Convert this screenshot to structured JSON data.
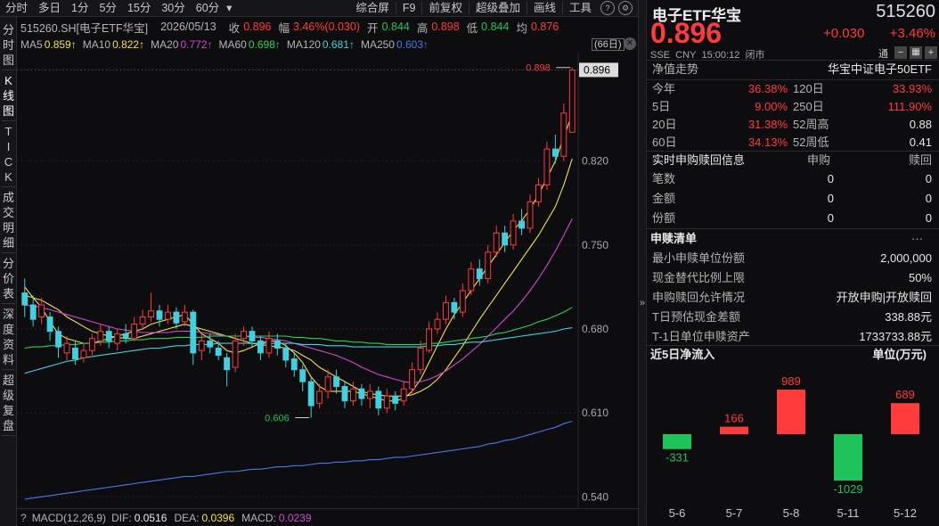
{
  "toolbar": {
    "items": [
      "分时",
      "多日",
      "1分",
      "5分",
      "15分",
      "30分",
      "60分"
    ],
    "right_items": [
      "综合屏",
      "F9",
      "前复权",
      "超级叠加",
      "画线",
      "工具"
    ]
  },
  "vtabs": {
    "groups": [
      [
        "分",
        "时",
        "图"
      ],
      [
        "K",
        "线",
        "图"
      ],
      [
        "T",
        "I",
        "C",
        "K"
      ],
      [
        "成",
        "交",
        "明",
        "细"
      ],
      [
        "分",
        "价",
        "表"
      ],
      [
        "深",
        "度",
        "资",
        "料"
      ],
      [
        "超",
        "级",
        "复",
        "盘"
      ]
    ]
  },
  "header": {
    "symbol": "515260.SH[电子ETF华宝]",
    "date": "2026/05/13",
    "close_label": "收",
    "close": "0.896",
    "change_label": "幅",
    "change": "3.46%(0.030)",
    "open_label": "开",
    "open": "0.844",
    "high_label": "高",
    "high": "0.898",
    "low_label": "低",
    "low": "0.844",
    "avg_label": "均",
    "avg": "0.876"
  },
  "ma": [
    {
      "label": "MA5",
      "value": "0.859↑",
      "color": "#f5e14b"
    },
    {
      "label": "MA10",
      "value": "0.822↑",
      "color": "#f5e14b"
    },
    {
      "label": "MA20",
      "value": "0.772↑",
      "color": "#d04ad0"
    },
    {
      "label": "MA60",
      "value": "0.698↑",
      "color": "#2ed15a"
    },
    {
      "label": "MA120",
      "value": "0.681↑",
      "color": "#40d0e0"
    },
    {
      "label": "MA250",
      "value": "0.603↑",
      "color": "#4a78e8"
    }
  ],
  "days_badge": "(66日)",
  "macd": {
    "label": "MACD(12,26,9)",
    "dif_label": "DIF:",
    "dif": "0.0516",
    "dea_label": "DEA:",
    "dea": "0.0396",
    "macd_label": "MACD:",
    "macd": "0.0239"
  },
  "chart_data": {
    "type": "candlestick",
    "ylim": [
      0.535,
      0.903
    ],
    "y_ticks": [
      "0.896",
      "0.820",
      "0.750",
      "0.680",
      "0.610",
      "0.540"
    ],
    "max_label": "0.898",
    "min_label": "0.606",
    "last_price": "0.896",
    "candles": [
      [
        0.71,
        0.7,
        0.722,
        0.69
      ],
      [
        0.7,
        0.688,
        0.708,
        0.682
      ],
      [
        0.69,
        0.7,
        0.706,
        0.684
      ],
      [
        0.69,
        0.678,
        0.694,
        0.67
      ],
      [
        0.678,
        0.665,
        0.682,
        0.656
      ],
      [
        0.66,
        0.668,
        0.674,
        0.654
      ],
      [
        0.664,
        0.655,
        0.67,
        0.65
      ],
      [
        0.656,
        0.662,
        0.668,
        0.652
      ],
      [
        0.662,
        0.672,
        0.676,
        0.658
      ],
      [
        0.67,
        0.678,
        0.684,
        0.666
      ],
      [
        0.678,
        0.67,
        0.682,
        0.664
      ],
      [
        0.668,
        0.676,
        0.68,
        0.662
      ],
      [
        0.676,
        0.672,
        0.684,
        0.668
      ],
      [
        0.672,
        0.684,
        0.69,
        0.67
      ],
      [
        0.684,
        0.69,
        0.696,
        0.68
      ],
      [
        0.69,
        0.695,
        0.71,
        0.686
      ],
      [
        0.695,
        0.688,
        0.7,
        0.682
      ],
      [
        0.688,
        0.694,
        0.7,
        0.684
      ],
      [
        0.694,
        0.685,
        0.698,
        0.68
      ],
      [
        0.686,
        0.694,
        0.7,
        0.682
      ],
      [
        0.694,
        0.66,
        0.696,
        0.65
      ],
      [
        0.662,
        0.67,
        0.676,
        0.654
      ],
      [
        0.67,
        0.665,
        0.676,
        0.66
      ],
      [
        0.664,
        0.658,
        0.67,
        0.654
      ],
      [
        0.656,
        0.646,
        0.66,
        0.632
      ],
      [
        0.648,
        0.67,
        0.676,
        0.644
      ],
      [
        0.672,
        0.678,
        0.682,
        0.666
      ],
      [
        0.678,
        0.67,
        0.682,
        0.664
      ],
      [
        0.67,
        0.66,
        0.674,
        0.654
      ],
      [
        0.66,
        0.672,
        0.678,
        0.656
      ],
      [
        0.67,
        0.664,
        0.676,
        0.658
      ],
      [
        0.664,
        0.654,
        0.668,
        0.648
      ],
      [
        0.655,
        0.646,
        0.66,
        0.64
      ],
      [
        0.646,
        0.636,
        0.65,
        0.628
      ],
      [
        0.636,
        0.616,
        0.64,
        0.606
      ],
      [
        0.618,
        0.628,
        0.634,
        0.614
      ],
      [
        0.628,
        0.64,
        0.646,
        0.622
      ],
      [
        0.64,
        0.632,
        0.646,
        0.626
      ],
      [
        0.632,
        0.62,
        0.636,
        0.614
      ],
      [
        0.62,
        0.63,
        0.636,
        0.616
      ],
      [
        0.63,
        0.622,
        0.634,
        0.616
      ],
      [
        0.622,
        0.628,
        0.634,
        0.614
      ],
      [
        0.628,
        0.614,
        0.632,
        0.608
      ],
      [
        0.614,
        0.624,
        0.63,
        0.61
      ],
      [
        0.624,
        0.618,
        0.628,
        0.612
      ],
      [
        0.62,
        0.63,
        0.636,
        0.616
      ],
      [
        0.63,
        0.646,
        0.652,
        0.626
      ],
      [
        0.646,
        0.664,
        0.67,
        0.642
      ],
      [
        0.662,
        0.68,
        0.686,
        0.66
      ],
      [
        0.68,
        0.688,
        0.694,
        0.676
      ],
      [
        0.688,
        0.702,
        0.708,
        0.684
      ],
      [
        0.702,
        0.694,
        0.706,
        0.688
      ],
      [
        0.694,
        0.712,
        0.718,
        0.69
      ],
      [
        0.712,
        0.73,
        0.736,
        0.708
      ],
      [
        0.73,
        0.722,
        0.738,
        0.716
      ],
      [
        0.722,
        0.744,
        0.75,
        0.718
      ],
      [
        0.744,
        0.76,
        0.766,
        0.74
      ],
      [
        0.76,
        0.75,
        0.766,
        0.744
      ],
      [
        0.75,
        0.77,
        0.776,
        0.746
      ],
      [
        0.77,
        0.764,
        0.78,
        0.758
      ],
      [
        0.764,
        0.786,
        0.792,
        0.76
      ],
      [
        0.786,
        0.8,
        0.806,
        0.782
      ],
      [
        0.8,
        0.83,
        0.836,
        0.796
      ],
      [
        0.83,
        0.824,
        0.842,
        0.818
      ],
      [
        0.824,
        0.86,
        0.868,
        0.82
      ],
      [
        0.844,
        0.896,
        0.898,
        0.844
      ]
    ],
    "ma_series": [
      {
        "name": "MA5",
        "color": "#f5e14b",
        "values": [
          0.715,
          0.706,
          0.698,
          0.686,
          0.676,
          0.672,
          0.67,
          0.668,
          0.668,
          0.67,
          0.672,
          0.674,
          0.676,
          0.678,
          0.68,
          0.684,
          0.686,
          0.688,
          0.69,
          0.692,
          0.684,
          0.676,
          0.672,
          0.668,
          0.662,
          0.66,
          0.662,
          0.665,
          0.668,
          0.67,
          0.67,
          0.666,
          0.66,
          0.652,
          0.64,
          0.632,
          0.628,
          0.628,
          0.628,
          0.628,
          0.626,
          0.624,
          0.622,
          0.62,
          0.62,
          0.622,
          0.628,
          0.638,
          0.652,
          0.666,
          0.68,
          0.692,
          0.702,
          0.712,
          0.722,
          0.732,
          0.742,
          0.752,
          0.762,
          0.77,
          0.78,
          0.792,
          0.806,
          0.82,
          0.84,
          0.859
        ]
      },
      {
        "name": "MA10",
        "color": "#f5e14b",
        "values": [
          0.708,
          0.706,
          0.704,
          0.7,
          0.696,
          0.69,
          0.686,
          0.682,
          0.678,
          0.676,
          0.674,
          0.673,
          0.672,
          0.672,
          0.674,
          0.676,
          0.678,
          0.68,
          0.682,
          0.684,
          0.682,
          0.68,
          0.678,
          0.676,
          0.674,
          0.672,
          0.67,
          0.668,
          0.667,
          0.666,
          0.665,
          0.664,
          0.662,
          0.658,
          0.654,
          0.648,
          0.644,
          0.64,
          0.636,
          0.632,
          0.628,
          0.626,
          0.625,
          0.624,
          0.624,
          0.624,
          0.625,
          0.628,
          0.632,
          0.638,
          0.646,
          0.656,
          0.666,
          0.677,
          0.688,
          0.698,
          0.708,
          0.718,
          0.728,
          0.738,
          0.748,
          0.758,
          0.77,
          0.782,
          0.8,
          0.822
        ]
      },
      {
        "name": "MA20",
        "color": "#d04ad0",
        "values": [
          0.7,
          0.699,
          0.698,
          0.696,
          0.694,
          0.692,
          0.69,
          0.688,
          0.686,
          0.684,
          0.682,
          0.68,
          0.679,
          0.678,
          0.677,
          0.677,
          0.677,
          0.677,
          0.678,
          0.678,
          0.678,
          0.677,
          0.676,
          0.675,
          0.674,
          0.674,
          0.674,
          0.673,
          0.673,
          0.672,
          0.671,
          0.67,
          0.668,
          0.666,
          0.664,
          0.662,
          0.66,
          0.658,
          0.655,
          0.652,
          0.648,
          0.645,
          0.642,
          0.64,
          0.638,
          0.636,
          0.635,
          0.636,
          0.638,
          0.641,
          0.645,
          0.65,
          0.655,
          0.661,
          0.667,
          0.674,
          0.681,
          0.688,
          0.695,
          0.703,
          0.712,
          0.722,
          0.733,
          0.745,
          0.758,
          0.772
        ]
      },
      {
        "name": "MA60",
        "color": "#2ed15a",
        "values": [
          0.664,
          0.665,
          0.665,
          0.666,
          0.666,
          0.667,
          0.667,
          0.668,
          0.668,
          0.669,
          0.669,
          0.67,
          0.67,
          0.671,
          0.671,
          0.672,
          0.672,
          0.672,
          0.673,
          0.673,
          0.673,
          0.673,
          0.674,
          0.674,
          0.674,
          0.674,
          0.674,
          0.674,
          0.674,
          0.674,
          0.674,
          0.674,
          0.673,
          0.673,
          0.672,
          0.672,
          0.671,
          0.67,
          0.67,
          0.669,
          0.669,
          0.668,
          0.668,
          0.667,
          0.667,
          0.667,
          0.667,
          0.667,
          0.668,
          0.668,
          0.669,
          0.67,
          0.671,
          0.672,
          0.673,
          0.674,
          0.676,
          0.677,
          0.679,
          0.681,
          0.683,
          0.686,
          0.688,
          0.691,
          0.694,
          0.698
        ]
      },
      {
        "name": "MA120",
        "color": "#40d0e0",
        "values": [
          0.643,
          0.645,
          0.647,
          0.649,
          0.651,
          0.653,
          0.654,
          0.656,
          0.657,
          0.658,
          0.659,
          0.66,
          0.661,
          0.662,
          0.663,
          0.664,
          0.664,
          0.665,
          0.666,
          0.666,
          0.667,
          0.667,
          0.667,
          0.668,
          0.668,
          0.668,
          0.668,
          0.668,
          0.668,
          0.668,
          0.668,
          0.668,
          0.668,
          0.667,
          0.667,
          0.667,
          0.666,
          0.666,
          0.666,
          0.665,
          0.665,
          0.665,
          0.665,
          0.665,
          0.665,
          0.665,
          0.665,
          0.665,
          0.666,
          0.666,
          0.667,
          0.667,
          0.668,
          0.669,
          0.669,
          0.67,
          0.671,
          0.672,
          0.673,
          0.674,
          0.675,
          0.676,
          0.677,
          0.678,
          0.68,
          0.681
        ]
      },
      {
        "name": "MA250",
        "color": "#4a78e8",
        "values": [
          0.538,
          0.539,
          0.54,
          0.541,
          0.542,
          0.543,
          0.544,
          0.545,
          0.546,
          0.547,
          0.548,
          0.549,
          0.55,
          0.551,
          0.552,
          0.553,
          0.554,
          0.555,
          0.556,
          0.557,
          0.557,
          0.558,
          0.559,
          0.56,
          0.561,
          0.561,
          0.562,
          0.563,
          0.563,
          0.564,
          0.565,
          0.565,
          0.566,
          0.566,
          0.567,
          0.568,
          0.568,
          0.569,
          0.569,
          0.57,
          0.57,
          0.571,
          0.571,
          0.572,
          0.573,
          0.573,
          0.574,
          0.575,
          0.576,
          0.577,
          0.578,
          0.579,
          0.58,
          0.581,
          0.582,
          0.584,
          0.585,
          0.587,
          0.588,
          0.59,
          0.592,
          0.594,
          0.596,
          0.598,
          0.601,
          0.603
        ]
      }
    ]
  },
  "quote": {
    "name": "电子ETF华宝",
    "code": "515260",
    "price": "0.896",
    "change": "+0.030",
    "change_pct": "+3.46%",
    "market": "SSE",
    "currency": "CNY",
    "time": "15:00:12",
    "status": "闭市",
    "tong": "通"
  },
  "nav": {
    "title": "净值走势",
    "index": "华宝中证电子50ETF",
    "rows": [
      {
        "l1": "今年",
        "v1": "36.38%",
        "l2": "120日",
        "v2": "33.93%"
      },
      {
        "l1": "5日",
        "v1": "9.00%",
        "l2": "250日",
        "v2": "111.90%"
      },
      {
        "l1": "20日",
        "v1": "31.38%",
        "l2": "52周高",
        "v2": "0.88"
      },
      {
        "l1": "60日",
        "v1": "34.13%",
        "l2": "52周低",
        "v2": "0.41"
      }
    ]
  },
  "realtime": {
    "title": "实时申购赎回信息",
    "col_buy": "申购",
    "col_sell": "赎回",
    "rows": [
      {
        "label": "笔数",
        "buy": "0",
        "sell": "0"
      },
      {
        "label": "金额",
        "buy": "0",
        "sell": "0"
      },
      {
        "label": "份额",
        "buy": "0",
        "sell": "0"
      }
    ]
  },
  "redemption": {
    "title": "申赎清单",
    "more": "···",
    "rows": [
      {
        "label": "最小申赎单位份额",
        "value": "2,000,000"
      },
      {
        "label": "现金替代比例上限",
        "value": "50%"
      },
      {
        "label": "申购赎回允许情况",
        "value": "开放申购|开放赎回"
      },
      {
        "label": "T日预估现金差额",
        "value": "338.88元"
      },
      {
        "label": "T-1日单位申赎资产",
        "value": "1733733.88元"
      }
    ]
  },
  "flow": {
    "title": "近5日净流入",
    "unit": "单位(万元)",
    "bars": [
      {
        "date": "5-6",
        "value": -331,
        "label": "-331"
      },
      {
        "date": "5-7",
        "value": 166,
        "label": "166"
      },
      {
        "date": "5-8",
        "value": 989,
        "label": "989"
      },
      {
        "date": "5-11",
        "value": -1029,
        "label": "-1029"
      },
      {
        "date": "5-12",
        "value": 689,
        "label": "689"
      }
    ],
    "colors": {
      "up": "#ff3b3b",
      "down": "#1ec45a"
    }
  },
  "colors": {
    "up": "#ff3b3b",
    "down": "#1ec45a",
    "down_candle": "#40d0e0"
  }
}
